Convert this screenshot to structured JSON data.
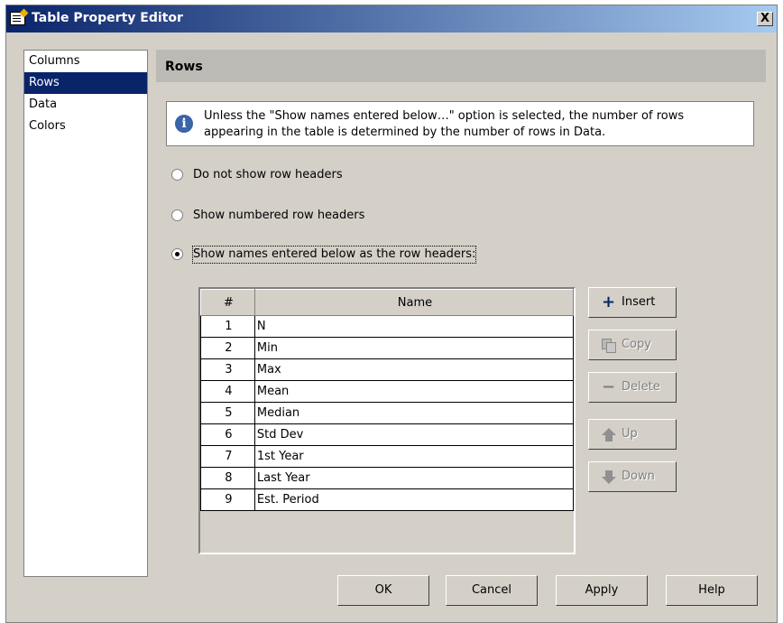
{
  "window": {
    "title": "Table Property Editor",
    "close_label": "X"
  },
  "nav": {
    "items": [
      {
        "label": "Columns",
        "selected": false
      },
      {
        "label": "Rows",
        "selected": true
      },
      {
        "label": "Data",
        "selected": false
      },
      {
        "label": "Colors",
        "selected": false
      }
    ]
  },
  "section": {
    "title": "Rows"
  },
  "info": {
    "icon": "info-icon",
    "line1": "Unless the \"Show names entered below…\" option is selected, the number of rows",
    "line2": "appearing in the table is determined by the number of rows in Data."
  },
  "options": [
    {
      "label": "Do not show row headers",
      "checked": false
    },
    {
      "label": "Show numbered row headers",
      "checked": false
    },
    {
      "label": "Show names entered below as the row headers:",
      "checked": true
    }
  ],
  "grid": {
    "headers": [
      "#",
      "Name"
    ],
    "rows": [
      [
        "1",
        "N"
      ],
      [
        "2",
        "Min"
      ],
      [
        "3",
        "Max"
      ],
      [
        "4",
        "Mean"
      ],
      [
        "5",
        "Median"
      ],
      [
        "6",
        "Std Dev"
      ],
      [
        "7",
        "1st Year"
      ],
      [
        "8",
        "Last Year"
      ],
      [
        "9",
        "Est. Period"
      ]
    ]
  },
  "side_buttons": {
    "insert": "Insert",
    "copy": "Copy",
    "delete": "Delete",
    "up": "Up",
    "down": "Down"
  },
  "footer": {
    "ok": "OK",
    "cancel": "Cancel",
    "apply": "Apply",
    "help": "Help"
  }
}
